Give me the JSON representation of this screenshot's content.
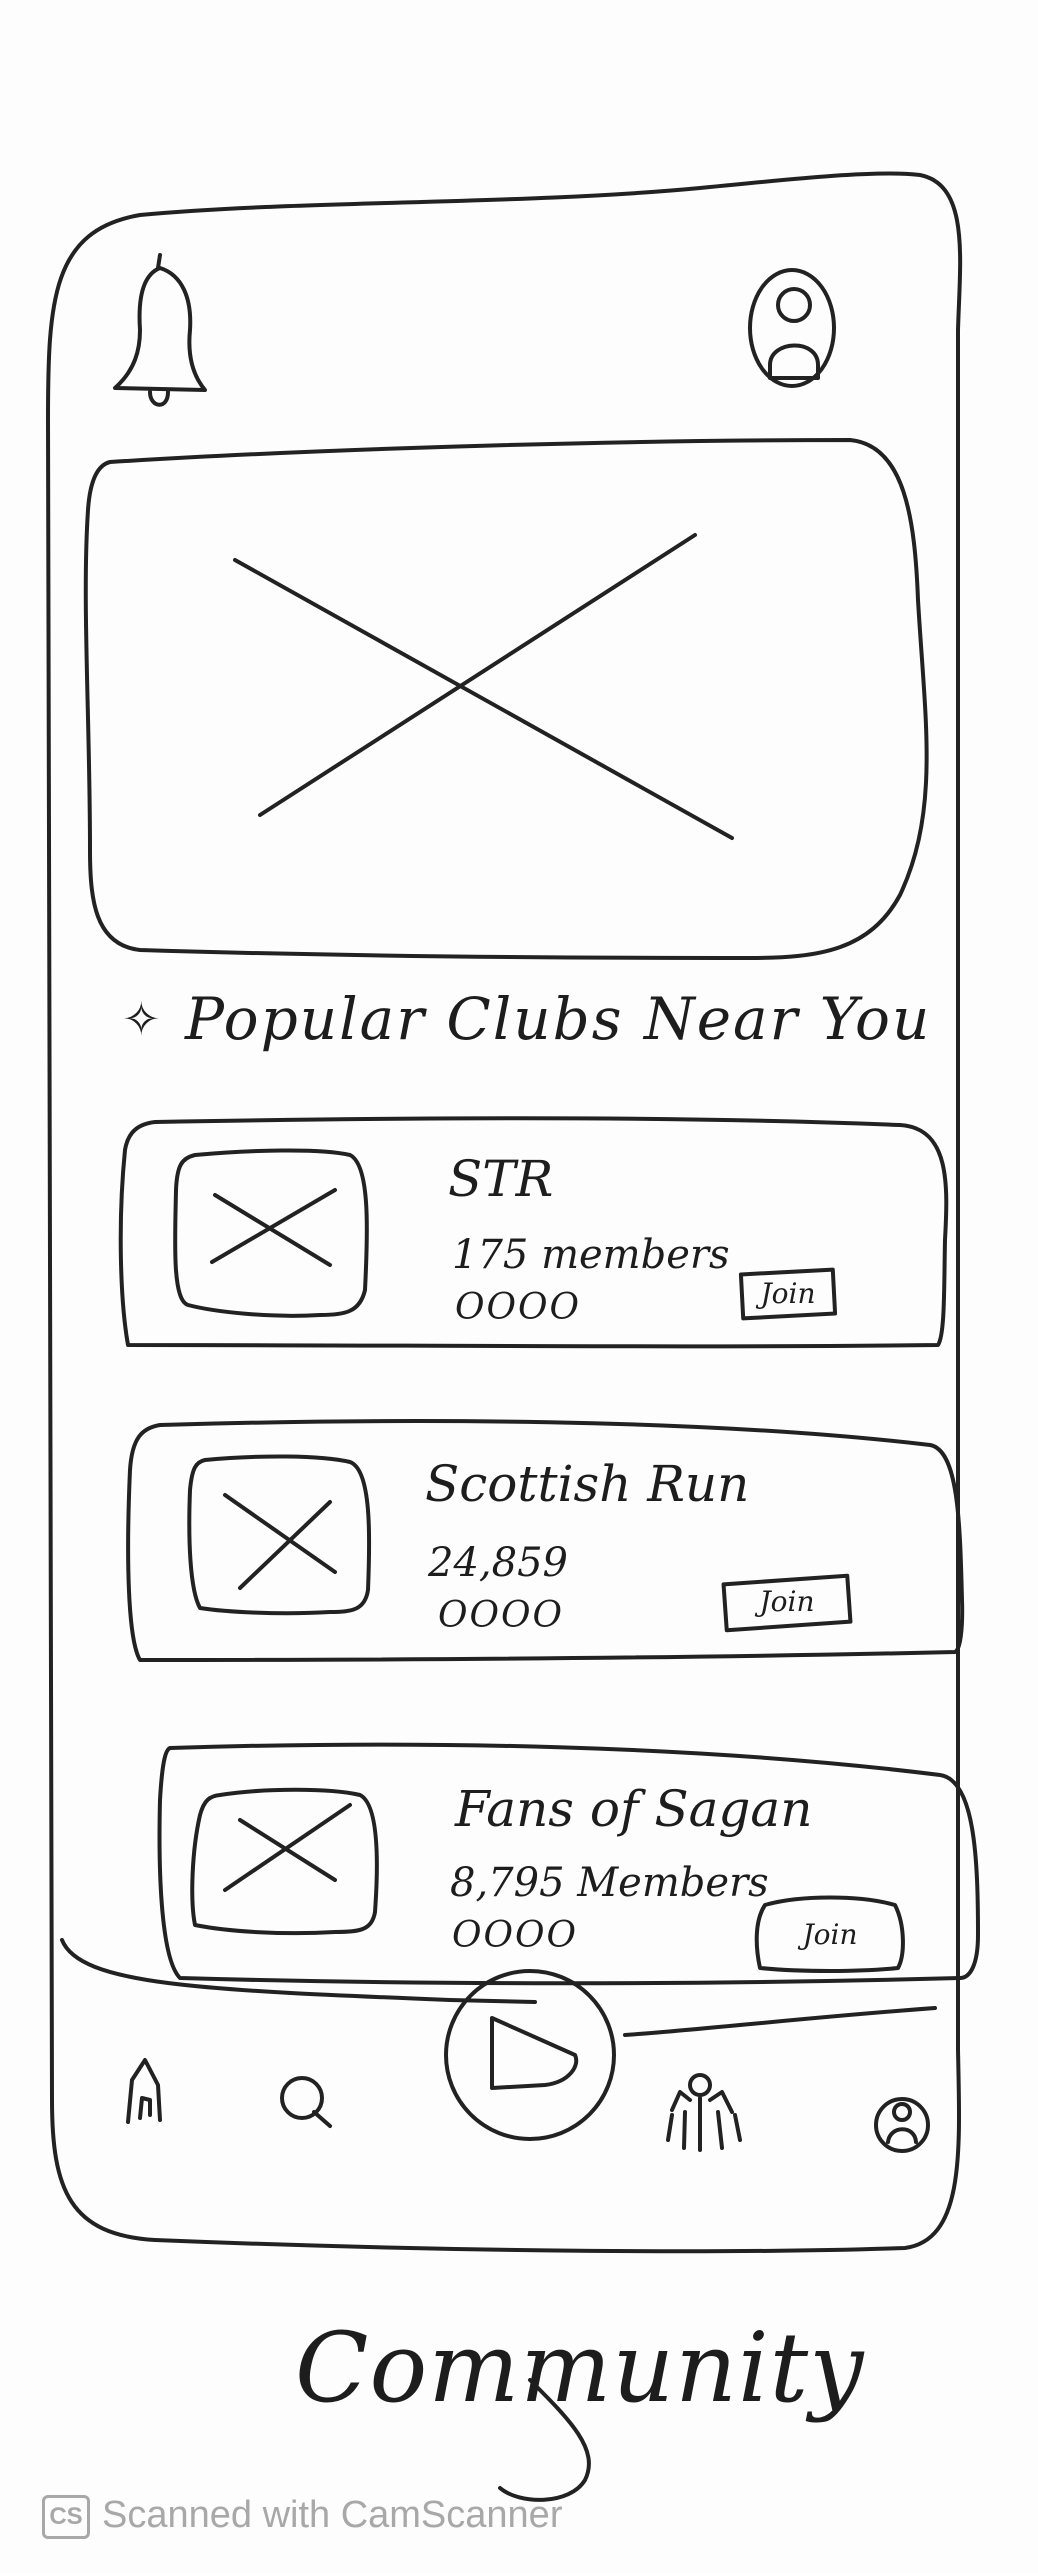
{
  "section": {
    "title": "Popular Clubs Near You",
    "star_glyph": "✧"
  },
  "clubs": [
    {
      "name": "STR",
      "members": "175 members",
      "rating": "OOOO",
      "join_label": "Join"
    },
    {
      "name": "Scottish Run",
      "members": "24,859",
      "rating": "OOOO",
      "join_label": "Join"
    },
    {
      "name": "Fans of Sagan",
      "members": "8,795 Members",
      "rating": "OOOO",
      "join_label": "Join"
    }
  ],
  "nav": {
    "items": [
      "home-icon",
      "search-icon",
      "play-icon",
      "community-icon",
      "profile-icon"
    ]
  },
  "header": {
    "icons": [
      "bell-icon",
      "avatar-icon"
    ]
  },
  "caption": "Community",
  "scanner": {
    "logo": "CS",
    "text": "Scanned with CamScanner"
  },
  "colors": {
    "ink": "#222222",
    "paper": "#fdfdfd",
    "watermark": "#a8a8a8"
  }
}
